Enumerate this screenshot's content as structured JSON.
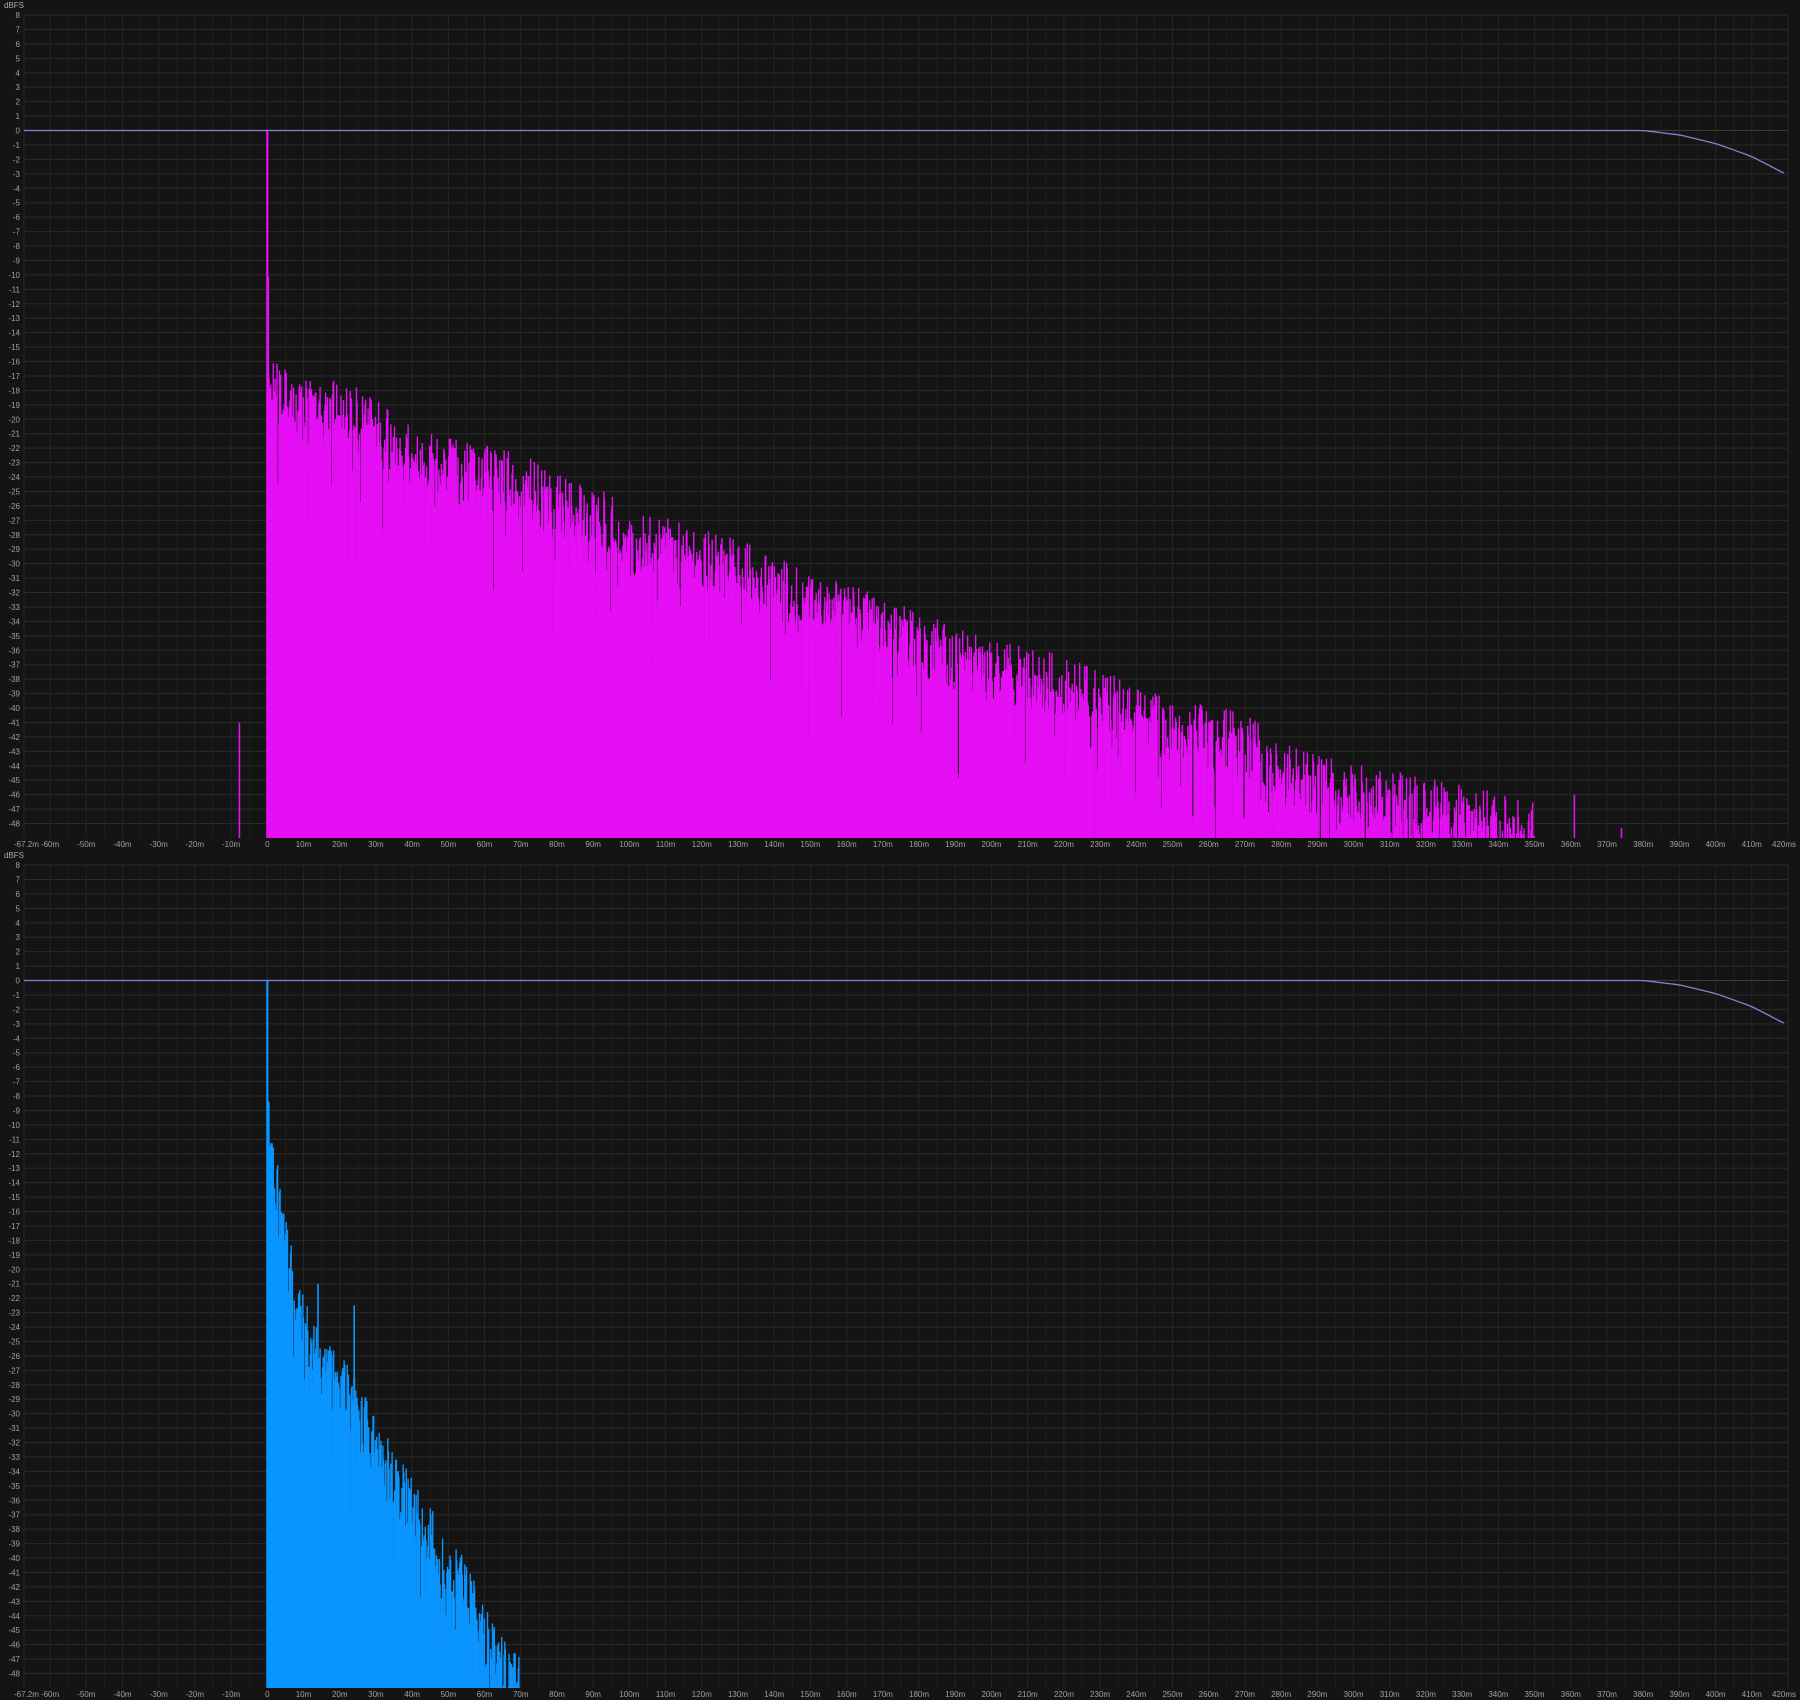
{
  "chart_data": [
    {
      "type": "bar",
      "title": "",
      "ylabel": "dBFS",
      "xlabel": "",
      "ylim": [
        -49,
        8
      ],
      "xlim": [
        -67.2,
        420
      ],
      "y_ticks": [
        "8",
        "7",
        "6",
        "5",
        "4",
        "3",
        "2",
        "1",
        "0",
        "-1",
        "-2",
        "-3",
        "-4",
        "-5",
        "-6",
        "-7",
        "-8",
        "-9",
        "-10",
        "-11",
        "-12",
        "-13",
        "-14",
        "-15",
        "-16",
        "-17",
        "-18",
        "-19",
        "-20",
        "-21",
        "-22",
        "-23",
        "-24",
        "-25",
        "-26",
        "-27",
        "-28",
        "-29",
        "-30",
        "-31",
        "-32",
        "-33",
        "-34",
        "-35",
        "-36",
        "-37",
        "-38",
        "-39",
        "-40",
        "-41",
        "-42",
        "-43",
        "-44",
        "-45",
        "-46",
        "-47",
        "-48"
      ],
      "x_tick_values": [
        -67.2,
        -60,
        -50,
        -40,
        -30,
        -20,
        -10,
        0,
        10,
        20,
        30,
        40,
        50,
        60,
        70,
        80,
        90,
        100,
        110,
        120,
        130,
        140,
        150,
        160,
        170,
        180,
        190,
        200,
        210,
        220,
        230,
        240,
        250,
        260,
        270,
        280,
        290,
        300,
        310,
        320,
        330,
        340,
        350,
        360,
        370,
        380,
        390,
        400,
        410,
        420
      ],
      "x_ticks": [
        "-67.2m",
        "-60m",
        "-50m",
        "-40m",
        "-30m",
        "-20m",
        "-10m",
        "0",
        "10m",
        "20m",
        "30m",
        "40m",
        "50m",
        "60m",
        "70m",
        "80m",
        "90m",
        "100m",
        "110m",
        "120m",
        "130m",
        "140m",
        "150m",
        "160m",
        "170m",
        "180m",
        "190m",
        "200m",
        "210m",
        "220m",
        "230m",
        "240m",
        "250m",
        "260m",
        "270m",
        "280m",
        "290m",
        "300m",
        "310m",
        "320m",
        "330m",
        "340m",
        "350m",
        "360m",
        "370m",
        "380m",
        "390m",
        "400m",
        "410m",
        "420ms"
      ],
      "grid": true,
      "colors": {
        "bars": "#e60ff5",
        "envelope": "#8b7fd6",
        "background": "#141414"
      },
      "envelope_curve": [
        [
          -67.2,
          0
        ],
        [
          380,
          0
        ],
        [
          390,
          -0.3
        ],
        [
          400,
          -0.9
        ],
        [
          410,
          -1.8
        ],
        [
          420,
          -3.1
        ]
      ],
      "impulse_envelope_db": [
        [
          0,
          0
        ],
        [
          0.6,
          -18
        ],
        [
          10,
          -20
        ],
        [
          20,
          -20
        ],
        [
          30,
          -21
        ],
        [
          40,
          -23
        ],
        [
          50,
          -24
        ],
        [
          60,
          -24.5
        ],
        [
          70,
          -25
        ],
        [
          80,
          -26.5
        ],
        [
          90,
          -27
        ],
        [
          100,
          -29
        ],
        [
          110,
          -29.5
        ],
        [
          120,
          -30
        ],
        [
          130,
          -31
        ],
        [
          140,
          -32
        ],
        [
          150,
          -33.5
        ],
        [
          160,
          -34
        ],
        [
          170,
          -35
        ],
        [
          180,
          -36
        ],
        [
          190,
          -37
        ],
        [
          200,
          -38
        ],
        [
          210,
          -38.5
        ],
        [
          220,
          -39
        ],
        [
          230,
          -40
        ],
        [
          240,
          -41
        ],
        [
          250,
          -42
        ],
        [
          260,
          -42.5
        ],
        [
          270,
          -43
        ],
        [
          280,
          -45
        ],
        [
          290,
          -46
        ],
        [
          300,
          -46.5
        ],
        [
          310,
          -47
        ],
        [
          320,
          -47.5
        ],
        [
          330,
          -48
        ],
        [
          340,
          -48.5
        ],
        [
          350,
          -49
        ]
      ],
      "isolated_spikes": [
        [
          -7.7,
          -41
        ],
        [
          361,
          -46
        ],
        [
          374,
          -48.3
        ]
      ]
    },
    {
      "type": "bar",
      "title": "",
      "ylabel": "dBFS",
      "xlabel": "",
      "ylim": [
        -49,
        8
      ],
      "xlim": [
        -67.2,
        420
      ],
      "y_ticks": [
        "8",
        "7",
        "6",
        "5",
        "4",
        "3",
        "2",
        "1",
        "0",
        "-1",
        "-2",
        "-3",
        "-4",
        "-5",
        "-6",
        "-7",
        "-8",
        "-9",
        "-10",
        "-11",
        "-12",
        "-13",
        "-14",
        "-15",
        "-16",
        "-17",
        "-18",
        "-19",
        "-20",
        "-21",
        "-22",
        "-23",
        "-24",
        "-25",
        "-26",
        "-27",
        "-28",
        "-29",
        "-30",
        "-31",
        "-32",
        "-33",
        "-34",
        "-35",
        "-36",
        "-37",
        "-38",
        "-39",
        "-40",
        "-41",
        "-42",
        "-43",
        "-44",
        "-45",
        "-46",
        "-47",
        "-48"
      ],
      "x_tick_values": [
        -67.2,
        -60,
        -50,
        -40,
        -30,
        -20,
        -10,
        0,
        10,
        20,
        30,
        40,
        50,
        60,
        70,
        80,
        90,
        100,
        110,
        120,
        130,
        140,
        150,
        160,
        170,
        180,
        190,
        200,
        210,
        220,
        230,
        240,
        250,
        260,
        270,
        280,
        290,
        300,
        310,
        320,
        330,
        340,
        350,
        360,
        370,
        380,
        390,
        400,
        410,
        420
      ],
      "x_ticks": [
        "-67.2m",
        "-60m",
        "-50m",
        "-40m",
        "-30m",
        "-20m",
        "-10m",
        "0",
        "10m",
        "20m",
        "30m",
        "40m",
        "50m",
        "60m",
        "70m",
        "80m",
        "90m",
        "100m",
        "110m",
        "120m",
        "130m",
        "140m",
        "150m",
        "160m",
        "170m",
        "180m",
        "190m",
        "200m",
        "210m",
        "220m",
        "230m",
        "240m",
        "250m",
        "260m",
        "270m",
        "280m",
        "290m",
        "300m",
        "310m",
        "320m",
        "330m",
        "340m",
        "350m",
        "360m",
        "370m",
        "380m",
        "390m",
        "400m",
        "410m",
        "420ms"
      ],
      "grid": true,
      "colors": {
        "bars": "#0a95ff",
        "envelope": "#8b7fd6",
        "background": "#141414"
      },
      "envelope_curve": [
        [
          -67.2,
          0
        ],
        [
          380,
          0
        ],
        [
          390,
          -0.3
        ],
        [
          400,
          -0.9
        ],
        [
          410,
          -1.8
        ],
        [
          420,
          -3.1
        ]
      ],
      "impulse_envelope_db": [
        [
          0,
          0
        ],
        [
          0.5,
          -11
        ],
        [
          2,
          -14
        ],
        [
          5,
          -19
        ],
        [
          8,
          -22
        ],
        [
          12,
          -26
        ],
        [
          18,
          -28
        ],
        [
          20,
          -28.5
        ],
        [
          25,
          -30
        ],
        [
          30,
          -33
        ],
        [
          35,
          -35
        ],
        [
          40,
          -37
        ],
        [
          45,
          -39
        ],
        [
          50,
          -41
        ],
        [
          55,
          -43
        ],
        [
          60,
          -46
        ],
        [
          63,
          -47.5
        ],
        [
          66,
          -48.5
        ],
        [
          70,
          -49
        ]
      ],
      "isolated_spikes": [
        [
          14,
          -21
        ],
        [
          24,
          -22.5
        ]
      ]
    }
  ]
}
